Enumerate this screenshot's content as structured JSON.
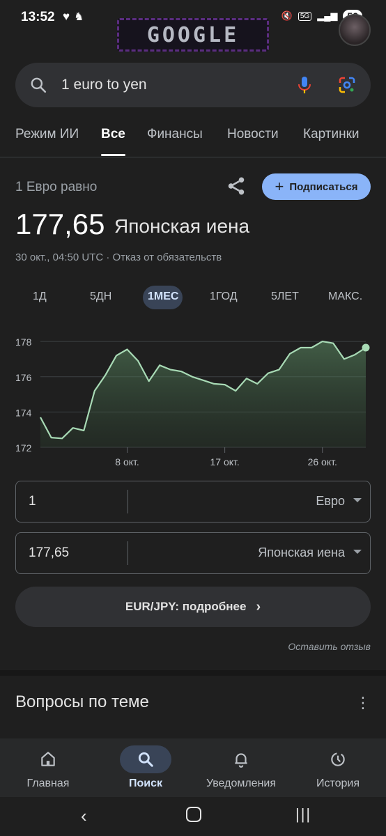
{
  "status": {
    "time": "13:52",
    "battery": "52",
    "network": "5G"
  },
  "doodle": {
    "text": "GOOGLE"
  },
  "search": {
    "query": "1 euro to yen"
  },
  "tabs": [
    {
      "label": "Режим ИИ"
    },
    {
      "label": "Все"
    },
    {
      "label": "Финансы"
    },
    {
      "label": "Новости"
    },
    {
      "label": "Картинки"
    }
  ],
  "result": {
    "equals_label": "1 Евро равно",
    "subscribe_label": "Подписаться",
    "value": "177,65",
    "unit": "Японская иена",
    "timestamp": "30 окт., 04:50 UTC · Отказ от обязательств"
  },
  "ranges": [
    "1Д",
    "5ДН",
    "1МЕС",
    "1ГОД",
    "5ЛЕТ",
    "МАКС."
  ],
  "chart_data": {
    "type": "area",
    "x_tick_labels": [
      "8 окт.",
      "17 окт.",
      "26 окт."
    ],
    "y_ticks": [
      172,
      174,
      176,
      178
    ],
    "ylim": [
      172,
      178.4
    ],
    "grid": true,
    "color": "#a8dab5",
    "values": [
      173.7,
      172.55,
      172.5,
      173.1,
      172.95,
      175.2,
      176.1,
      177.2,
      177.55,
      176.9,
      175.75,
      176.65,
      176.4,
      176.3,
      176.0,
      175.8,
      175.6,
      175.55,
      175.2,
      175.9,
      175.6,
      176.2,
      176.4,
      177.3,
      177.65,
      177.65,
      178.0,
      177.9,
      177.0,
      177.25,
      177.65
    ]
  },
  "converter": {
    "from_amount": "1",
    "from_currency": "Евро",
    "to_amount": "177,65",
    "to_currency": "Японская иена"
  },
  "details_label": "EUR/JPY: подробнее",
  "feedback_label": "Оставить отзыв",
  "related_title": "Вопросы по теме",
  "bottom_nav": [
    {
      "label": "Главная"
    },
    {
      "label": "Поиск"
    },
    {
      "label": "Уведомления"
    },
    {
      "label": "История"
    }
  ]
}
